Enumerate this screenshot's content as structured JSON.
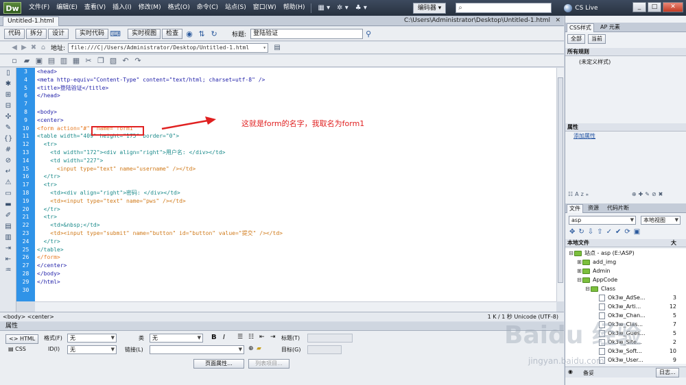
{
  "app": {
    "logo": "Dw"
  },
  "menu": [
    "文件(F)",
    "编辑(E)",
    "查看(V)",
    "插入(I)",
    "修改(M)",
    "格式(O)",
    "命令(C)",
    "站点(S)",
    "窗口(W)",
    "帮助(H)"
  ],
  "workspace": "编码器 ▾",
  "cslive": "CS Live",
  "window_buttons": [
    "_",
    "□",
    "✕"
  ],
  "document": {
    "tab": "Untitled-1.html",
    "path": "C:\\Users\\Administrator\\Desktop\\Untitled-1.html",
    "close": "✕"
  },
  "doc_toolbar": {
    "code": "代码",
    "split": "拆分",
    "design": "设计",
    "live_code": "实时代码",
    "live_view": "实时视图",
    "inspect": "检查",
    "title_label": "标题:",
    "title_value": "登陆验证"
  },
  "address": {
    "label": "地址:",
    "value": "file:///C|/Users/Administrator/Desktop/Untitled-1.html"
  },
  "code_lines": [
    {
      "n": "3",
      "text": "<head>",
      "cls": "tag"
    },
    {
      "n": "4",
      "text": "<meta http-equiv=\"Content-Type\" content=\"text/html; charset=utf-8\" />",
      "cls": "tag"
    },
    {
      "n": "5",
      "text": "<title>登陆验证</title>",
      "cls": "tag"
    },
    {
      "n": "6",
      "text": "</head>",
      "cls": "tag"
    },
    {
      "n": "7",
      "text": "",
      "cls": "plain"
    },
    {
      "n": "8",
      "text": "<body>",
      "cls": "tag"
    },
    {
      "n": "9",
      "text": "<center>",
      "cls": "tag"
    },
    {
      "n": "10",
      "text": "<form action=\"#\"  name=\"form1\"",
      "cls": "form"
    },
    {
      "n": "11",
      "text": "<table width=\"409\" height=\"175\" border=\"0\">",
      "cls": "table"
    },
    {
      "n": "12",
      "text": "  <tr>",
      "cls": "table"
    },
    {
      "n": "13",
      "text": "    <td width=\"172\"><div align=\"right\">用户名: </div></td>",
      "cls": "table"
    },
    {
      "n": "14",
      "text": "    <td width=\"227\">",
      "cls": "table"
    },
    {
      "n": "15",
      "text": "      <input type=\"text\" name=\"username\" /></td>",
      "cls": "input"
    },
    {
      "n": "16",
      "text": "  </tr>",
      "cls": "table"
    },
    {
      "n": "17",
      "text": "  <tr>",
      "cls": "table"
    },
    {
      "n": "18",
      "text": "    <td><div align=\"right\">密码: </div></td>",
      "cls": "table"
    },
    {
      "n": "19",
      "text": "    <td><input type=\"text\" name=\"pws\" /></td>",
      "cls": "input"
    },
    {
      "n": "20",
      "text": "  </tr>",
      "cls": "table"
    },
    {
      "n": "21",
      "text": "  <tr>",
      "cls": "table"
    },
    {
      "n": "22",
      "text": "    <td>&nbsp;</td>",
      "cls": "table"
    },
    {
      "n": "23",
      "text": "    <td><input type=\"submit\" name=\"button\" id=\"button\" value=\"提交\" /></td>",
      "cls": "input"
    },
    {
      "n": "24",
      "text": "  </tr>",
      "cls": "table"
    },
    {
      "n": "25",
      "text": "</table>",
      "cls": "table"
    },
    {
      "n": "26",
      "text": "</form>",
      "cls": "form"
    },
    {
      "n": "27",
      "text": "</center>",
      "cls": "tag"
    },
    {
      "n": "28",
      "text": "</body>",
      "cls": "tag"
    },
    {
      "n": "29",
      "text": "</html>",
      "cls": "tag"
    },
    {
      "n": "30",
      "text": "",
      "cls": "plain"
    }
  ],
  "annotation": {
    "text": "这就是form的名字，我取名为form1",
    "color": "#e02020"
  },
  "status": {
    "tags": "<body> <center>",
    "right": "1 K / 1 秒  Unicode (UTF-8)"
  },
  "properties": {
    "title": "属性",
    "html": "HTML",
    "css": "CSS",
    "format_label": "格式(F)",
    "format_value": "无",
    "class_label": "类",
    "class_value": "无",
    "id_label": "ID(I)",
    "id_value": "无",
    "link_label": "链接(L)",
    "title_label": "标题(T)",
    "target_label": "目标(G)",
    "bold": "B",
    "italic": "I",
    "page_props": "页面属性...",
    "list_item": "列表项目..."
  },
  "css_panel": {
    "tabs": [
      "CSS样式",
      "AP 元素"
    ],
    "all": "全部",
    "current": "当前",
    "all_rules": "所有规则",
    "undefined": "(未定义样式)",
    "attributes": "属性",
    "add_attr": "添加属性"
  },
  "files_panel": {
    "tabs": [
      "文件",
      "资源",
      "代码片断"
    ],
    "site": "asp",
    "view": "本地视图",
    "header_name": "本地文件",
    "header_size": "大",
    "tree": [
      {
        "indent": 0,
        "exp": "⊟",
        "type": "folder",
        "name": "站点 - asp (E:\\ASP)",
        "size": ""
      },
      {
        "indent": 1,
        "exp": "⊞",
        "type": "folder",
        "name": "add_img",
        "size": ""
      },
      {
        "indent": 1,
        "exp": "⊞",
        "type": "folder",
        "name": "Admin",
        "size": ""
      },
      {
        "indent": 1,
        "exp": "⊟",
        "type": "folder",
        "name": "AppCode",
        "size": ""
      },
      {
        "indent": 2,
        "exp": "⊟",
        "type": "folder",
        "name": "Class",
        "size": ""
      },
      {
        "indent": 3,
        "exp": "",
        "type": "file",
        "name": "Ok3w_AdSe...",
        "size": "3"
      },
      {
        "indent": 3,
        "exp": "",
        "type": "file",
        "name": "Ok3w_Arti...",
        "size": "12"
      },
      {
        "indent": 3,
        "exp": "",
        "type": "file",
        "name": "Ok3w_Chan...",
        "size": "5"
      },
      {
        "indent": 3,
        "exp": "",
        "type": "file",
        "name": "Ok3w_Clas...",
        "size": "7"
      },
      {
        "indent": 3,
        "exp": "",
        "type": "file",
        "name": "Ok3w_Gues...",
        "size": "5"
      },
      {
        "indent": 3,
        "exp": "",
        "type": "file",
        "name": "Ok3w_Site...",
        "size": "2"
      },
      {
        "indent": 3,
        "exp": "",
        "type": "file",
        "name": "Ok3w_Soft...",
        "size": "10"
      },
      {
        "indent": 3,
        "exp": "",
        "type": "file",
        "name": "Ok3w_User...",
        "size": "9"
      }
    ],
    "log_left": "备妥",
    "log_button": "日志..."
  },
  "watermark": {
    "text": "Baidu 经验",
    "url": "jingyan.baidu.com"
  }
}
